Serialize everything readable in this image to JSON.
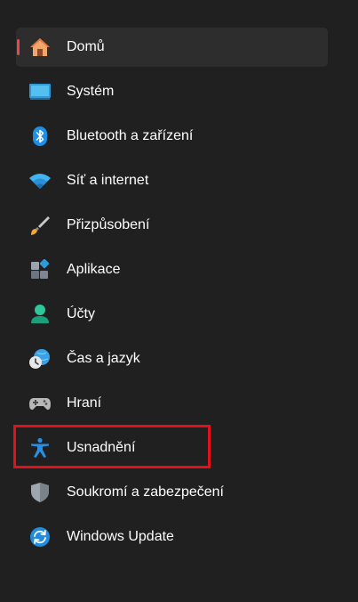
{
  "nav": {
    "items": [
      {
        "label": "Domů",
        "icon": "home-icon",
        "active": true
      },
      {
        "label": "Systém",
        "icon": "system-monitor-icon"
      },
      {
        "label": "Bluetooth a zařízení",
        "icon": "bluetooth-icon"
      },
      {
        "label": "Síť a internet",
        "icon": "wifi-icon"
      },
      {
        "label": "Přizpůsobení",
        "icon": "paintbrush-icon"
      },
      {
        "label": "Aplikace",
        "icon": "apps-icon"
      },
      {
        "label": "Účty",
        "icon": "account-icon"
      },
      {
        "label": "Čas a jazyk",
        "icon": "time-language-icon"
      },
      {
        "label": "Hraní",
        "icon": "gamepad-icon"
      },
      {
        "label": "Usnadnění",
        "icon": "accessibility-icon"
      },
      {
        "label": "Soukromí a zabezpečení",
        "icon": "shield-icon"
      },
      {
        "label": "Windows Update",
        "icon": "update-icon"
      }
    ]
  },
  "colors": {
    "background": "#202020",
    "active_background": "#2d2d2d",
    "active_indicator": "#e5484d",
    "highlight_box": "#e3101a",
    "text": "#ffffff"
  }
}
